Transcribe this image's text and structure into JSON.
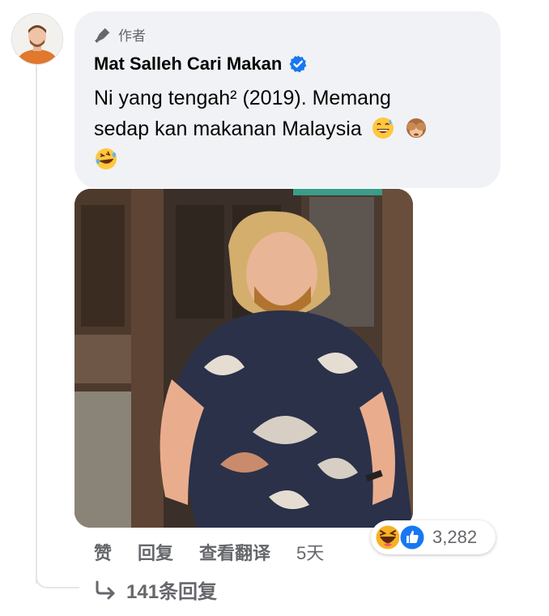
{
  "comment": {
    "author_badge_label": "作者",
    "author_name": "Mat Salleh Cari Makan",
    "text_line1": "Ni yang tengah² (2019). Memang",
    "text_line2": "sedap kan makanan Malaysia",
    "emoji": [
      "grinning-sweat-emoji",
      "see-no-evil-monkey-emoji",
      "rolling-laughing-emoji"
    ]
  },
  "actions": {
    "like": "赞",
    "reply": "回复",
    "translate": "查看翻译",
    "time": "5天"
  },
  "reactions": {
    "count": "3,282",
    "types": [
      "haha",
      "like"
    ]
  },
  "replies": {
    "label": "141条回复"
  },
  "colors": {
    "bubble": "#f0f2f5",
    "meta_text": "#65676b",
    "like_blue": "#1877f2",
    "haha_yellow": "#f7b125",
    "verified_blue": "#1877f2"
  }
}
